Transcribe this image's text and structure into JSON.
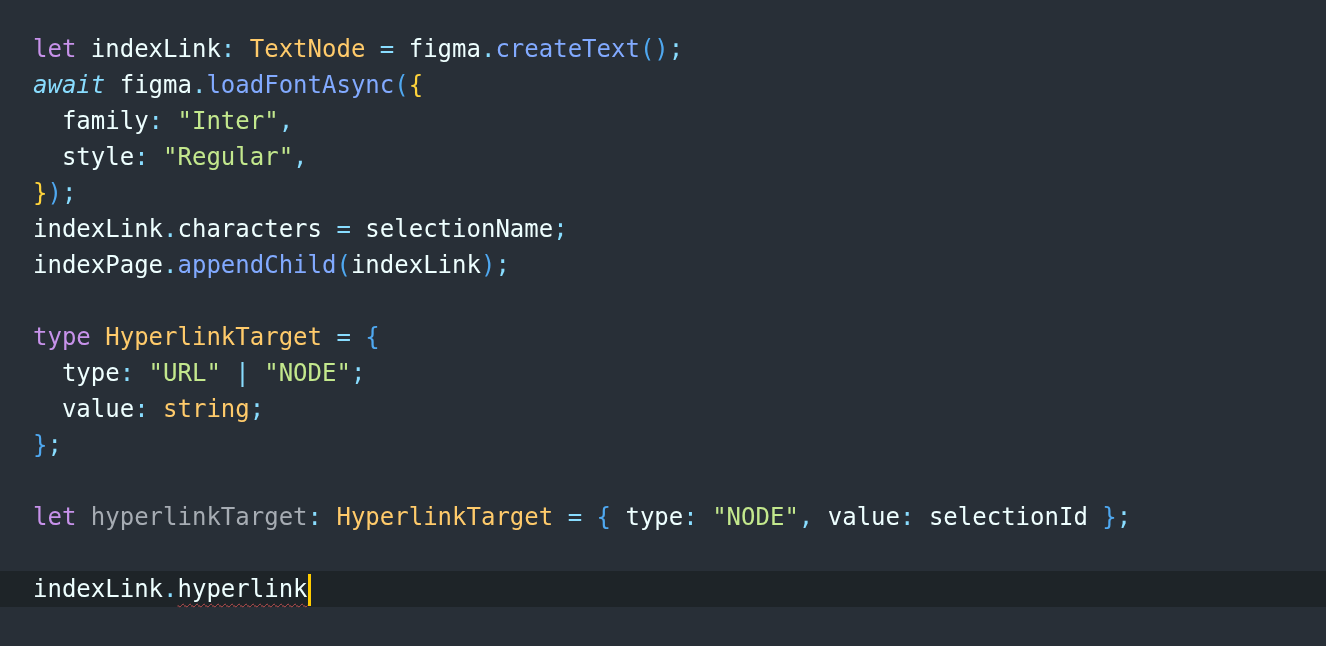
{
  "editor": {
    "lines": [
      {
        "current": false,
        "tokens": [
          {
            "kind": "keyword",
            "text": "let"
          },
          {
            "kind": "plain",
            "text": " indexLink"
          },
          {
            "kind": "punct",
            "text": ":"
          },
          {
            "kind": "type",
            "text": " TextNode"
          },
          {
            "kind": "punct",
            "text": " ="
          },
          {
            "kind": "plain",
            "text": " figma"
          },
          {
            "kind": "punct",
            "text": "."
          },
          {
            "kind": "func",
            "text": "createText"
          },
          {
            "kind": "bracket",
            "text": "()"
          },
          {
            "kind": "punct",
            "text": ";"
          }
        ]
      },
      {
        "current": false,
        "tokens": [
          {
            "kind": "keyword-italic",
            "text": "await"
          },
          {
            "kind": "plain",
            "text": " figma"
          },
          {
            "kind": "punct",
            "text": "."
          },
          {
            "kind": "func",
            "text": "loadFontAsync"
          },
          {
            "kind": "bracket",
            "text": "("
          },
          {
            "kind": "brace",
            "text": "{"
          }
        ]
      },
      {
        "current": false,
        "tokens": [
          {
            "kind": "plain",
            "text": "  family"
          },
          {
            "kind": "punct",
            "text": ":"
          },
          {
            "kind": "string",
            "text": " \"Inter\""
          },
          {
            "kind": "punct",
            "text": ","
          }
        ]
      },
      {
        "current": false,
        "tokens": [
          {
            "kind": "plain",
            "text": "  style"
          },
          {
            "kind": "punct",
            "text": ":"
          },
          {
            "kind": "string",
            "text": " \"Regular\""
          },
          {
            "kind": "punct",
            "text": ","
          }
        ]
      },
      {
        "current": false,
        "tokens": [
          {
            "kind": "brace",
            "text": "}"
          },
          {
            "kind": "bracket",
            "text": ")"
          },
          {
            "kind": "punct",
            "text": ";"
          }
        ]
      },
      {
        "current": false,
        "tokens": [
          {
            "kind": "plain",
            "text": "indexLink"
          },
          {
            "kind": "punct",
            "text": "."
          },
          {
            "kind": "plain",
            "text": "characters "
          },
          {
            "kind": "punct",
            "text": "="
          },
          {
            "kind": "plain",
            "text": " selectionName"
          },
          {
            "kind": "punct",
            "text": ";"
          }
        ]
      },
      {
        "current": false,
        "tokens": [
          {
            "kind": "plain",
            "text": "indexPage"
          },
          {
            "kind": "punct",
            "text": "."
          },
          {
            "kind": "func",
            "text": "appendChild"
          },
          {
            "kind": "bracket",
            "text": "("
          },
          {
            "kind": "plain",
            "text": "indexLink"
          },
          {
            "kind": "bracket",
            "text": ")"
          },
          {
            "kind": "punct",
            "text": ";"
          }
        ]
      },
      {
        "current": false
      },
      {
        "current": false,
        "tokens": [
          {
            "kind": "keyword",
            "text": "type"
          },
          {
            "kind": "type",
            "text": " HyperlinkTarget"
          },
          {
            "kind": "punct",
            "text": " ="
          },
          {
            "kind": "bracket",
            "text": " {"
          }
        ]
      },
      {
        "current": false,
        "tokens": [
          {
            "kind": "plain",
            "text": "  type"
          },
          {
            "kind": "punct",
            "text": ":"
          },
          {
            "kind": "string",
            "text": " \"URL\""
          },
          {
            "kind": "punct",
            "text": " |"
          },
          {
            "kind": "string",
            "text": " \"NODE\""
          },
          {
            "kind": "punct",
            "text": ";"
          }
        ]
      },
      {
        "current": false,
        "tokens": [
          {
            "kind": "plain",
            "text": "  value"
          },
          {
            "kind": "punct",
            "text": ":"
          },
          {
            "kind": "type",
            "text": " string"
          },
          {
            "kind": "punct",
            "text": ";"
          }
        ]
      },
      {
        "current": false,
        "tokens": [
          {
            "kind": "bracket",
            "text": "}"
          },
          {
            "kind": "punct",
            "text": ";"
          }
        ]
      },
      {
        "current": false
      },
      {
        "current": false,
        "tokens": [
          {
            "kind": "keyword",
            "text": "let"
          },
          {
            "kind": "unused",
            "text": " hyperlinkTarget"
          },
          {
            "kind": "punct",
            "text": ":"
          },
          {
            "kind": "type",
            "text": " HyperlinkTarget"
          },
          {
            "kind": "punct",
            "text": " ="
          },
          {
            "kind": "bracket",
            "text": " {"
          },
          {
            "kind": "plain",
            "text": " type"
          },
          {
            "kind": "punct",
            "text": ":"
          },
          {
            "kind": "string",
            "text": " \"NODE\""
          },
          {
            "kind": "punct",
            "text": ","
          },
          {
            "kind": "plain",
            "text": " value"
          },
          {
            "kind": "punct",
            "text": ":"
          },
          {
            "kind": "plain",
            "text": " selectionId "
          },
          {
            "kind": "bracket",
            "text": "}"
          },
          {
            "kind": "punct",
            "text": ";"
          }
        ]
      },
      {
        "current": false
      },
      {
        "current": true,
        "tokens": [
          {
            "kind": "plain",
            "text": "indexLink"
          },
          {
            "kind": "punct",
            "text": "."
          },
          {
            "kind": "error",
            "text": "hyperlink"
          }
        ]
      }
    ]
  }
}
